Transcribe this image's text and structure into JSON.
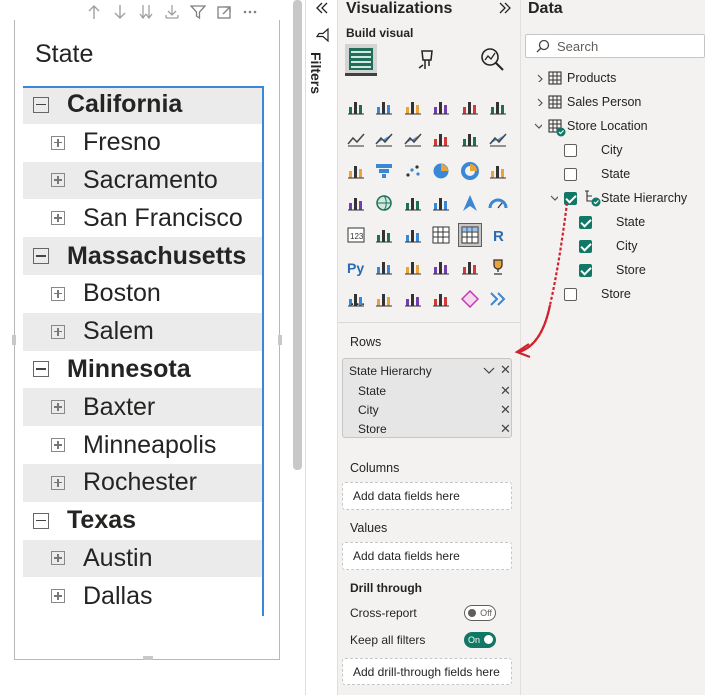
{
  "matrix": {
    "title": "State",
    "rows": [
      {
        "type": "state",
        "label": "California",
        "icon": "collapse-icon"
      },
      {
        "type": "city",
        "label": "Fresno",
        "icon": "expand-icon"
      },
      {
        "type": "city",
        "label": "Sacramento",
        "icon": "expand-icon"
      },
      {
        "type": "city",
        "label": "San Francisco",
        "icon": "expand-icon"
      },
      {
        "type": "state",
        "label": "Massachusetts",
        "icon": "collapse-icon"
      },
      {
        "type": "city",
        "label": "Boston",
        "icon": "expand-icon"
      },
      {
        "type": "city",
        "label": "Salem",
        "icon": "expand-icon"
      },
      {
        "type": "state",
        "label": "Minnesota",
        "icon": "collapse-icon"
      },
      {
        "type": "city",
        "label": "Baxter",
        "icon": "expand-icon"
      },
      {
        "type": "city",
        "label": "Minneapolis",
        "icon": "expand-icon"
      },
      {
        "type": "city",
        "label": "Rochester",
        "icon": "expand-icon"
      },
      {
        "type": "state",
        "label": "Texas",
        "icon": "collapse-icon"
      },
      {
        "type": "city",
        "label": "Austin",
        "icon": "expand-icon"
      },
      {
        "type": "city",
        "label": "Dallas",
        "icon": "expand-icon"
      }
    ],
    "toolbar_icons": [
      "drill-up-icon",
      "drill-down-icon",
      "expand-all-down-icon",
      "expand-next-level-icon",
      "filter-icon",
      "focus-mode-icon",
      "more-options-icon"
    ]
  },
  "filters": {
    "label": "Filters"
  },
  "visualizations": {
    "title": "Visualizations",
    "build_label": "Build visual",
    "more": "...",
    "wells": {
      "rows_title": "Rows",
      "rows_header": "State Hierarchy",
      "rows_fields": [
        "State",
        "City",
        "Store"
      ],
      "columns_title": "Columns",
      "columns_placeholder": "Add data fields here",
      "values_title": "Values",
      "values_placeholder": "Add data fields here",
      "drill_title": "Drill through",
      "cross_report": "Cross-report",
      "cross_report_state": "Off",
      "keep_filters": "Keep all filters",
      "keep_filters_state": "On",
      "drill_placeholder": "Add drill-through fields here"
    }
  },
  "data": {
    "title": "Data",
    "search_placeholder": "Search",
    "tables": {
      "products": "Products",
      "sales_person": "Sales Person",
      "store_location": "Store Location",
      "city": "City",
      "state": "State",
      "state_hierarchy": "State Hierarchy",
      "h_state": "State",
      "h_city": "City",
      "h_store": "Store",
      "store": "Store"
    }
  },
  "colors": {
    "accent": "#3a87d6",
    "checkbox": "#117865",
    "annotation": "#d0222f"
  }
}
